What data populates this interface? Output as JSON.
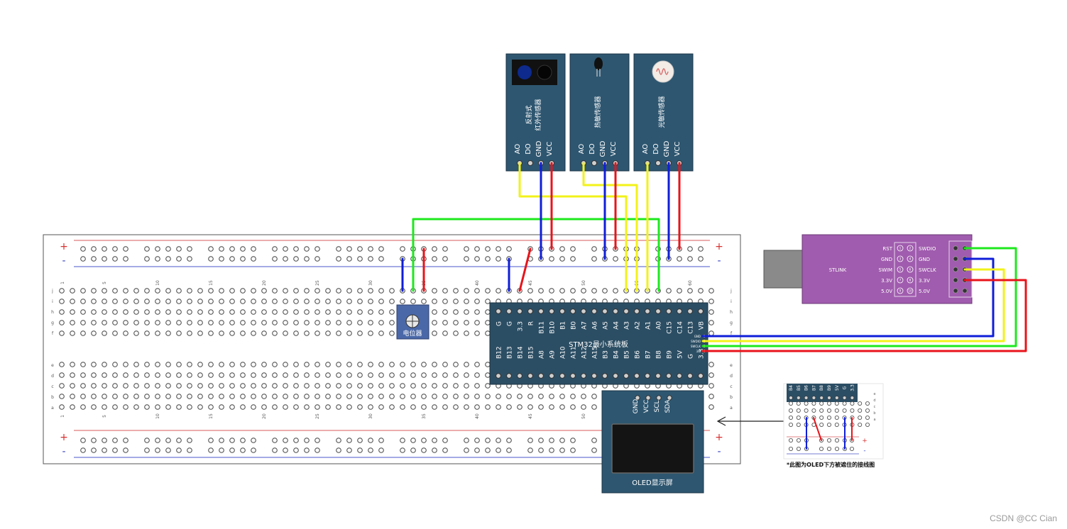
{
  "breadboard": {
    "plus": "+",
    "minus": "-",
    "col_numbers": [
      "1",
      "5",
      "10",
      "15",
      "20",
      "25",
      "30",
      "35",
      "40",
      "45",
      "50",
      "55",
      "60"
    ],
    "row_letters_top": [
      "j",
      "i",
      "h",
      "g",
      "f"
    ],
    "row_letters_bottom": [
      "e",
      "d",
      "c",
      "b",
      "a"
    ]
  },
  "sensors": [
    {
      "title_lines": [
        "反射式",
        "红外传感器"
      ],
      "pins": [
        "AO",
        "DO",
        "GND",
        "VCC"
      ],
      "icon": "ir-emitter-receiver-icon"
    },
    {
      "title_lines": [
        "热敏传感器"
      ],
      "pins": [
        "AO",
        "DO",
        "GND",
        "VCC"
      ],
      "icon": "thermistor-icon"
    },
    {
      "title_lines": [
        "光敏传感器"
      ],
      "pins": [
        "AO",
        "DO",
        "GND",
        "VCC"
      ],
      "icon": "photoresistor-icon"
    }
  ],
  "potentiometer": {
    "label": "电位器",
    "icon": "potentiometer-knob-icon"
  },
  "stm32": {
    "label": "STM32最小系统板",
    "top_pins": [
      "G",
      "G",
      "3.3",
      "R",
      "B11",
      "B10",
      "B1",
      "B0",
      "A7",
      "A6",
      "A5",
      "A4",
      "A3",
      "A2",
      "A1",
      "A0",
      "C15",
      "C14",
      "C13",
      "VB"
    ],
    "bottom_pins": [
      "B12",
      "B13",
      "B14",
      "B15",
      "A8",
      "A9",
      "A10",
      "A11",
      "A12",
      "A15",
      "B3",
      "B4",
      "B5",
      "B6",
      "B7",
      "B8",
      "B9",
      "5V",
      "G",
      "3.3"
    ],
    "side_pins": [
      "GND",
      "SWDIO",
      "SWCLK",
      "3.3"
    ]
  },
  "oled": {
    "label": "OLED显示屏",
    "pins": [
      "GND",
      "VCC",
      "SCL",
      "SDA"
    ]
  },
  "stlink": {
    "label": "STLINK",
    "left_labels": [
      "RST",
      "GND",
      "SWIM",
      "3.3V",
      "5.0V"
    ],
    "right_labels": [
      "SWDIO",
      "GND",
      "SWCLK",
      "3.3V",
      "5.0V"
    ],
    "pin_numbers_left": [
      "1",
      "3",
      "5",
      "7",
      "9"
    ],
    "pin_numbers_right": [
      "2",
      "4",
      "6",
      "8",
      "10"
    ]
  },
  "inset": {
    "pins": [
      "B4",
      "B5",
      "B6",
      "B7",
      "B8",
      "B9",
      "5V",
      "G",
      "3.3"
    ],
    "row_letters": [
      "e",
      "d",
      "c",
      "b",
      "a"
    ],
    "plus": "+",
    "minus": "-",
    "caption": "*此图为OLED下方被遮住的接线图"
  },
  "watermark": "CSDN @CC Cian",
  "colors": {
    "wire_red": "#e8141b",
    "wire_blue": "#0f1ed8",
    "wire_green": "#1ee81e",
    "wire_yellow": "#f2f21a",
    "module_teal": "#2e5670",
    "stlink_purple": "#a05cae",
    "stm32_board": "#2c4e64",
    "rail_red": "#d85a5a",
    "rail_blue": "#4a55c8"
  }
}
